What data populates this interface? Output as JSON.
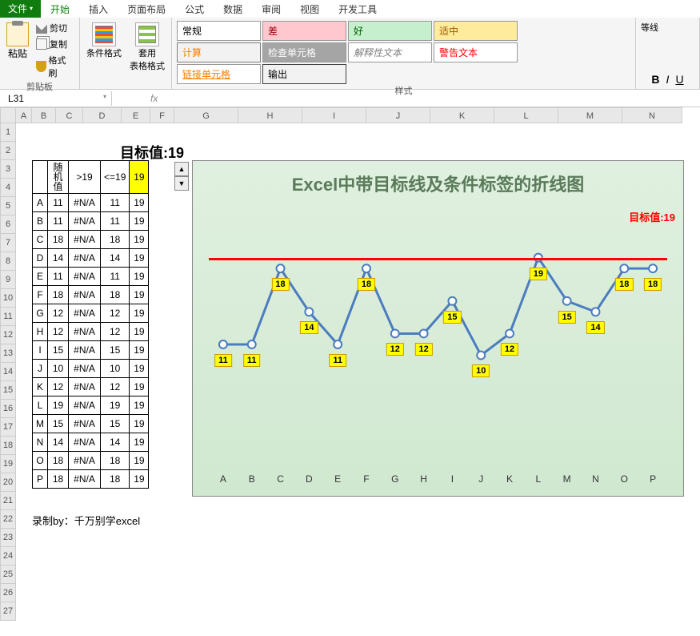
{
  "tabs": {
    "file": "文件",
    "list": [
      "开始",
      "插入",
      "页面布局",
      "公式",
      "数据",
      "审阅",
      "视图",
      "开发工具"
    ],
    "active": 0
  },
  "clipboard": {
    "paste": "粘贴",
    "cut": "剪切",
    "copy": "复制",
    "brush": "格式刷",
    "group": "剪贴板"
  },
  "cond_fmt": "条件格式",
  "tbl_fmt": "套用\n表格格式",
  "styles": {
    "group": "样式",
    "cells": [
      "常规",
      "差",
      "好",
      "适中",
      "计算",
      "检查单元格",
      "解释性文本",
      "警告文本",
      "链接单元格",
      "输出"
    ]
  },
  "font": {
    "group": "等线",
    "b": "B",
    "i": "I",
    "u": "U"
  },
  "namebox": "L31",
  "fx": "fx",
  "cols": [
    "A",
    "B",
    "C",
    "D",
    "E",
    "F",
    "G",
    "H",
    "I",
    "J",
    "K",
    "L",
    "M",
    "N"
  ],
  "rows": [
    "1",
    "2",
    "3",
    "4",
    "5",
    "6",
    "7",
    "8",
    "9",
    "10",
    "11",
    "12",
    "13",
    "14",
    "15",
    "16",
    "17",
    "18",
    "19",
    "20",
    "21",
    "22",
    "23",
    "24",
    "25",
    "26",
    "27"
  ],
  "target_label": "目标值:19",
  "table": {
    "hdr": {
      "rand": "随\n机\n值",
      "gt": ">19",
      "lte": "<=19",
      "val": "19"
    },
    "rows": [
      {
        "k": "A",
        "v": 11,
        "gt": "#N/A",
        "lte": 11,
        "t": 19
      },
      {
        "k": "B",
        "v": 11,
        "gt": "#N/A",
        "lte": 11,
        "t": 19
      },
      {
        "k": "C",
        "v": 18,
        "gt": "#N/A",
        "lte": 18,
        "t": 19
      },
      {
        "k": "D",
        "v": 14,
        "gt": "#N/A",
        "lte": 14,
        "t": 19
      },
      {
        "k": "E",
        "v": 11,
        "gt": "#N/A",
        "lte": 11,
        "t": 19
      },
      {
        "k": "F",
        "v": 18,
        "gt": "#N/A",
        "lte": 18,
        "t": 19
      },
      {
        "k": "G",
        "v": 12,
        "gt": "#N/A",
        "lte": 12,
        "t": 19
      },
      {
        "k": "H",
        "v": 12,
        "gt": "#N/A",
        "lte": 12,
        "t": 19
      },
      {
        "k": "I",
        "v": 15,
        "gt": "#N/A",
        "lte": 15,
        "t": 19
      },
      {
        "k": "J",
        "v": 10,
        "gt": "#N/A",
        "lte": 10,
        "t": 19
      },
      {
        "k": "K",
        "v": 12,
        "gt": "#N/A",
        "lte": 12,
        "t": 19
      },
      {
        "k": "L",
        "v": 19,
        "gt": "#N/A",
        "lte": 19,
        "t": 19
      },
      {
        "k": "M",
        "v": 15,
        "gt": "#N/A",
        "lte": 15,
        "t": 19
      },
      {
        "k": "N",
        "v": 14,
        "gt": "#N/A",
        "lte": 14,
        "t": 19
      },
      {
        "k": "O",
        "v": 18,
        "gt": "#N/A",
        "lte": 18,
        "t": 19
      },
      {
        "k": "P",
        "v": 18,
        "gt": "#N/A",
        "lte": 18,
        "t": 19
      }
    ]
  },
  "footer": "录制by：千万别学excel",
  "chart_data": {
    "type": "line",
    "title": "Excel中带目标线及条件标签的折线图",
    "target_label": "目标值:19",
    "target": 19,
    "ylim": [
      0,
      22
    ],
    "categories": [
      "A",
      "B",
      "C",
      "D",
      "E",
      "F",
      "G",
      "H",
      "I",
      "J",
      "K",
      "L",
      "M",
      "N",
      "O",
      "P"
    ],
    "values": [
      11,
      11,
      18,
      14,
      11,
      18,
      12,
      12,
      15,
      10,
      12,
      19,
      15,
      14,
      18,
      18
    ]
  }
}
